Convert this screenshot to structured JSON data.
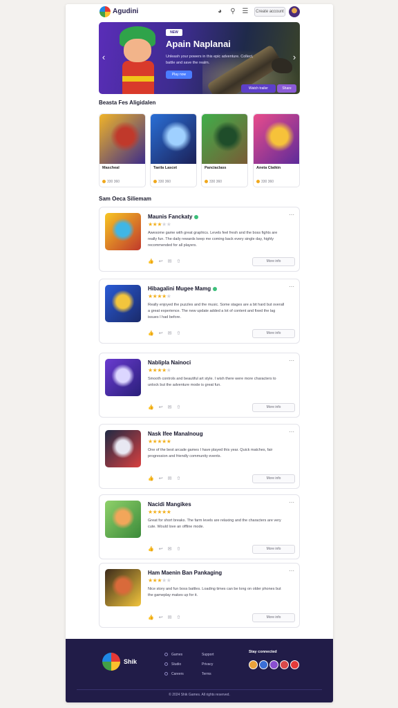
{
  "header": {
    "logo_text": "Agudini",
    "action_button": "Create account"
  },
  "banner": {
    "tag": "NEW",
    "title": "Apain Naplanai",
    "subtitle": "Unleash your powers in this epic adventure. Collect, battle and save the realm.",
    "button": "Play now",
    "cta_primary": "Watch trailer",
    "cta_secondary": "Share"
  },
  "featured": {
    "title": "Beasta Fes Aligidalen",
    "items": [
      {
        "name": "Mascheal",
        "price": "330 360",
        "colors": [
          "#f0b429",
          "#c0392b",
          "#3a2a8a"
        ]
      },
      {
        "name": "Taeila Lascet",
        "price": "330 360",
        "colors": [
          "#2a6fd6",
          "#9fd0ff",
          "#1b1f55"
        ]
      },
      {
        "name": "Panciaclass",
        "price": "330 360",
        "colors": [
          "#3fae4a",
          "#1f4d2a",
          "#7a5a35"
        ]
      },
      {
        "name": "Aneta Clatkin",
        "price": "330 360",
        "colors": [
          "#e94c8b",
          "#f6c23a",
          "#5b2a9a"
        ]
      }
    ]
  },
  "reviews": {
    "title": "Sam Oeca Siliemam",
    "items": [
      {
        "title": "Maunis Fanckaty",
        "stars": 3,
        "verified": true,
        "text": "Awesome game with great graphics. Levels feel fresh and the boss fights are really fun. The daily rewards keep me coming back every single day, highly recommended for all players.",
        "icon_colors": [
          "#f7c623",
          "#3fb6e6",
          "#c0392b"
        ],
        "more": "More info"
      },
      {
        "title": "Hibagalini Mugee Mamg",
        "stars": 4,
        "verified": true,
        "text": "Really enjoyed the puzzles and the music. Some stages are a bit hard but overall a great experience. The new update added a lot of content and fixed the lag issues I had before.",
        "icon_colors": [
          "#2a5bd6",
          "#f2c53d",
          "#1a2a6a"
        ],
        "more": "More info"
      },
      {
        "title": "Nablipla Nainoci",
        "stars": 4,
        "verified": false,
        "text": "Smooth controls and beautiful art style. I wish there were more characters to unlock but the adventure mode is great fun.",
        "icon_colors": [
          "#6a3bd0",
          "#dcd6ff",
          "#2a1f7a"
        ],
        "more": "More info"
      },
      {
        "title": "Nask Ifee Manalnoug",
        "stars": 5,
        "verified": false,
        "text": "One of the best arcade games I have played this year. Quick matches, fair progression and friendly community events.",
        "icon_colors": [
          "#1f2a44",
          "#e8e8f2",
          "#d94040"
        ],
        "more": "More info"
      },
      {
        "title": "Nacidi Mangikes",
        "stars": 5,
        "verified": false,
        "text": "Great for short breaks. The farm levels are relaxing and the characters are very cute. Would love an offline mode.",
        "icon_colors": [
          "#8fd16a",
          "#f2a65a",
          "#3b8a3a"
        ],
        "more": "More info"
      },
      {
        "title": "Ham Maenin Ban Pankaging",
        "stars": 3,
        "verified": false,
        "text": "Nice story and fun boss battles. Loading times can be long on older phones but the gameplay makes up for it.",
        "icon_colors": [
          "#3b2a1a",
          "#d96a3a",
          "#f2c53d"
        ],
        "more": "More info"
      }
    ]
  },
  "footer": {
    "brand": "Shik",
    "links_col1": [
      "Games",
      "Studio",
      "Careers"
    ],
    "links_col2": [
      "Support",
      "Privacy",
      "Terms"
    ],
    "social_title": "Stay connected",
    "social_colors": [
      "#e9a23b",
      "#3a6fd6",
      "#8a4fd0",
      "#d94a4a",
      "#e23a3a"
    ],
    "copyright": "© 2024 Shik Games. All rights reserved."
  }
}
